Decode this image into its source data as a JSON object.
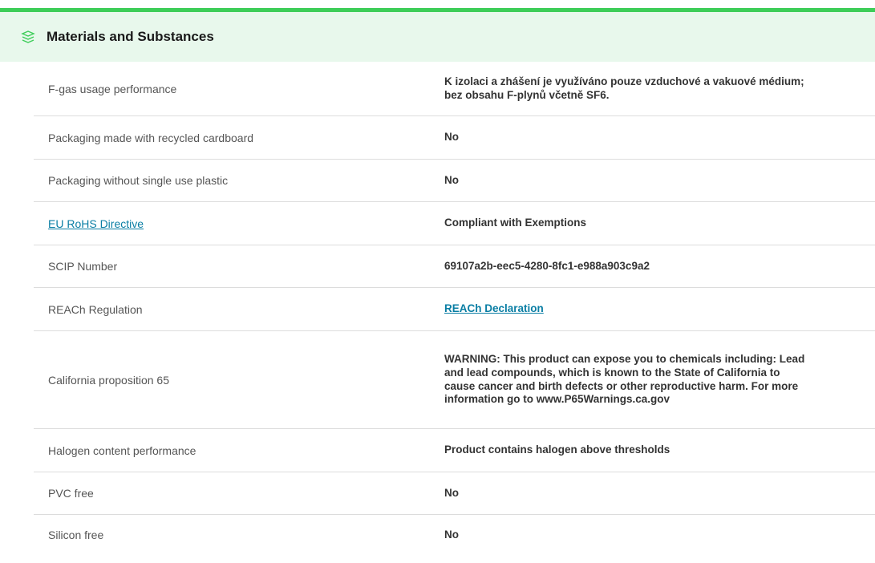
{
  "section": {
    "title": "Materials and Substances",
    "icon": "layers-icon",
    "accent_color": "#3dcd58",
    "header_bg": "#e8f8ec"
  },
  "rows": [
    {
      "label": "F-gas usage performance",
      "value": "K izolaci a zhášení je využíváno pouze vzduchové a vakuové médium; bez obsahu F-plynů včetně SF6."
    },
    {
      "label": "Packaging made with recycled cardboard",
      "value": "No"
    },
    {
      "label": "Packaging without single use plastic",
      "value": "No"
    },
    {
      "label": "EU RoHS Directive",
      "value": "Compliant with Exemptions"
    },
    {
      "label": "SCIP Number",
      "value": "69107a2b-eec5-4280-8fc1-e988a903c9a2"
    },
    {
      "label": "REACh Regulation",
      "value": "REACh Declaration"
    },
    {
      "label": "California proposition 65",
      "value": "WARNING: This product can expose you to chemicals including: Lead and lead compounds, which is known to the State of California to cause cancer and birth defects or other reproductive harm. For more information go to www.P65Warnings.ca.gov"
    },
    {
      "label": "Halogen content performance",
      "value": "Product contains halogen above thresholds"
    },
    {
      "label": "PVC free",
      "value": "No"
    },
    {
      "label": "Silicon free",
      "value": "No"
    }
  ]
}
